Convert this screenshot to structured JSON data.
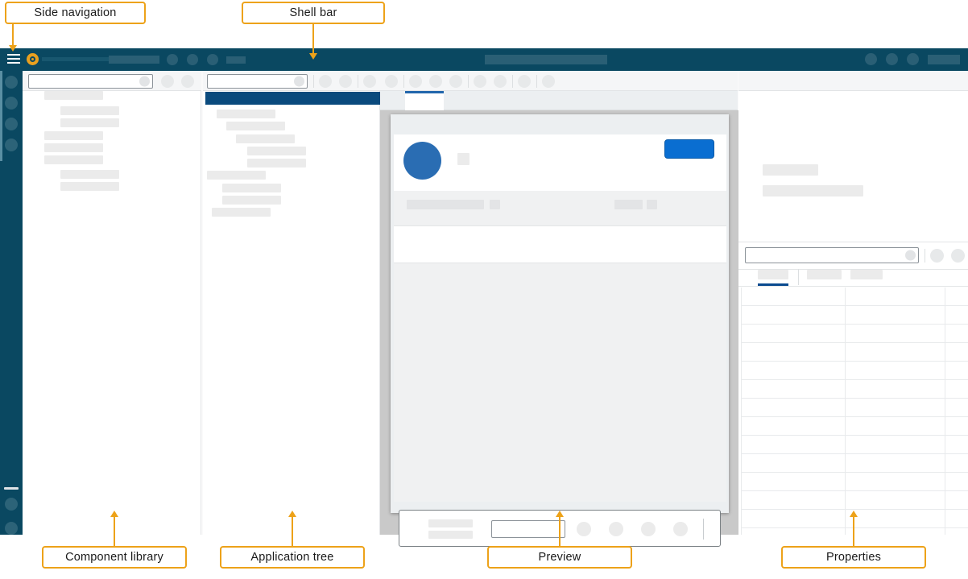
{
  "annotations": [
    {
      "id": "side-navigation",
      "label": "Side navigation"
    },
    {
      "id": "shell-bar",
      "label": "Shell bar"
    },
    {
      "id": "component-library",
      "label": "Component library"
    },
    {
      "id": "application-tree",
      "label": "Application tree"
    },
    {
      "id": "preview",
      "label": "Preview"
    },
    {
      "id": "properties",
      "label": "Properties"
    }
  ],
  "colors": {
    "annotation_border": "#eda219",
    "shell_bar_bg": "#0a4861",
    "side_nav_bg": "#0a4861",
    "logo": "#e9a020",
    "selected_row": "#0a4a7d",
    "avatar": "#2a6db3",
    "primary_button": "#0a6ed1",
    "active_tab_indicator": "#2166ac",
    "canvas_bg": "#c9c9c9",
    "skeleton": "#ebebeb"
  },
  "shell_bar": {
    "menu_icon": "hamburger-menu-icon",
    "logo_icon": "app-logo-icon",
    "title_placeholder": "",
    "search_placeholder": "",
    "actions": [
      "action-1",
      "action-2",
      "action-3",
      "overflow-action"
    ],
    "right_actions": [
      "notifications",
      "settings",
      "help",
      "user-profile"
    ]
  },
  "side_navigation": {
    "items": [
      "nav-item-1",
      "nav-item-2",
      "nav-item-3",
      "nav-item-4"
    ],
    "bottom_items": [
      "nav-bottom-1",
      "nav-bottom-2"
    ],
    "selected_index": 0
  },
  "component_library": {
    "search_placeholder": "",
    "toolbar_actions": [
      "filter",
      "sort"
    ],
    "items": [
      {
        "indent": 0
      },
      {
        "indent": 1
      },
      {
        "indent": 1
      },
      {
        "indent": 0
      },
      {
        "indent": 0
      },
      {
        "indent": 0
      },
      {
        "indent": 1
      },
      {
        "indent": 1
      }
    ]
  },
  "application_tree": {
    "search_placeholder": "",
    "toolbar_actions": [
      "add",
      "delete",
      "more"
    ],
    "selected_index": 0,
    "items": [
      {
        "indent": 1
      },
      {
        "indent": 2
      },
      {
        "indent": 3
      },
      {
        "indent": 4
      },
      {
        "indent": 4
      },
      {
        "indent": 0
      },
      {
        "indent": 2
      },
      {
        "indent": 2
      },
      {
        "indent": 1
      }
    ]
  },
  "preview": {
    "toolbar_actions": [
      "undo",
      "redo",
      "cut",
      "copy",
      "paste",
      "zoom-in",
      "zoom-out",
      "device"
    ],
    "tabs": [
      {
        "label": "",
        "active": true
      }
    ],
    "card": {
      "avatar_icon": "user-avatar",
      "title_placeholder": "",
      "primary_button_label": ""
    },
    "footer": {
      "input_placeholder": "",
      "actions": [
        "action-a",
        "action-b",
        "action-c",
        "action-d"
      ]
    }
  },
  "properties": {
    "header_rows": 2,
    "search_placeholder": "",
    "toolbar_actions": [
      "settings",
      "more"
    ],
    "tabs": [
      {
        "label": "",
        "active": true
      },
      {
        "label": "",
        "active": false
      },
      {
        "label": "",
        "active": false
      }
    ],
    "table": {
      "rows": 16,
      "columns": 3
    }
  }
}
